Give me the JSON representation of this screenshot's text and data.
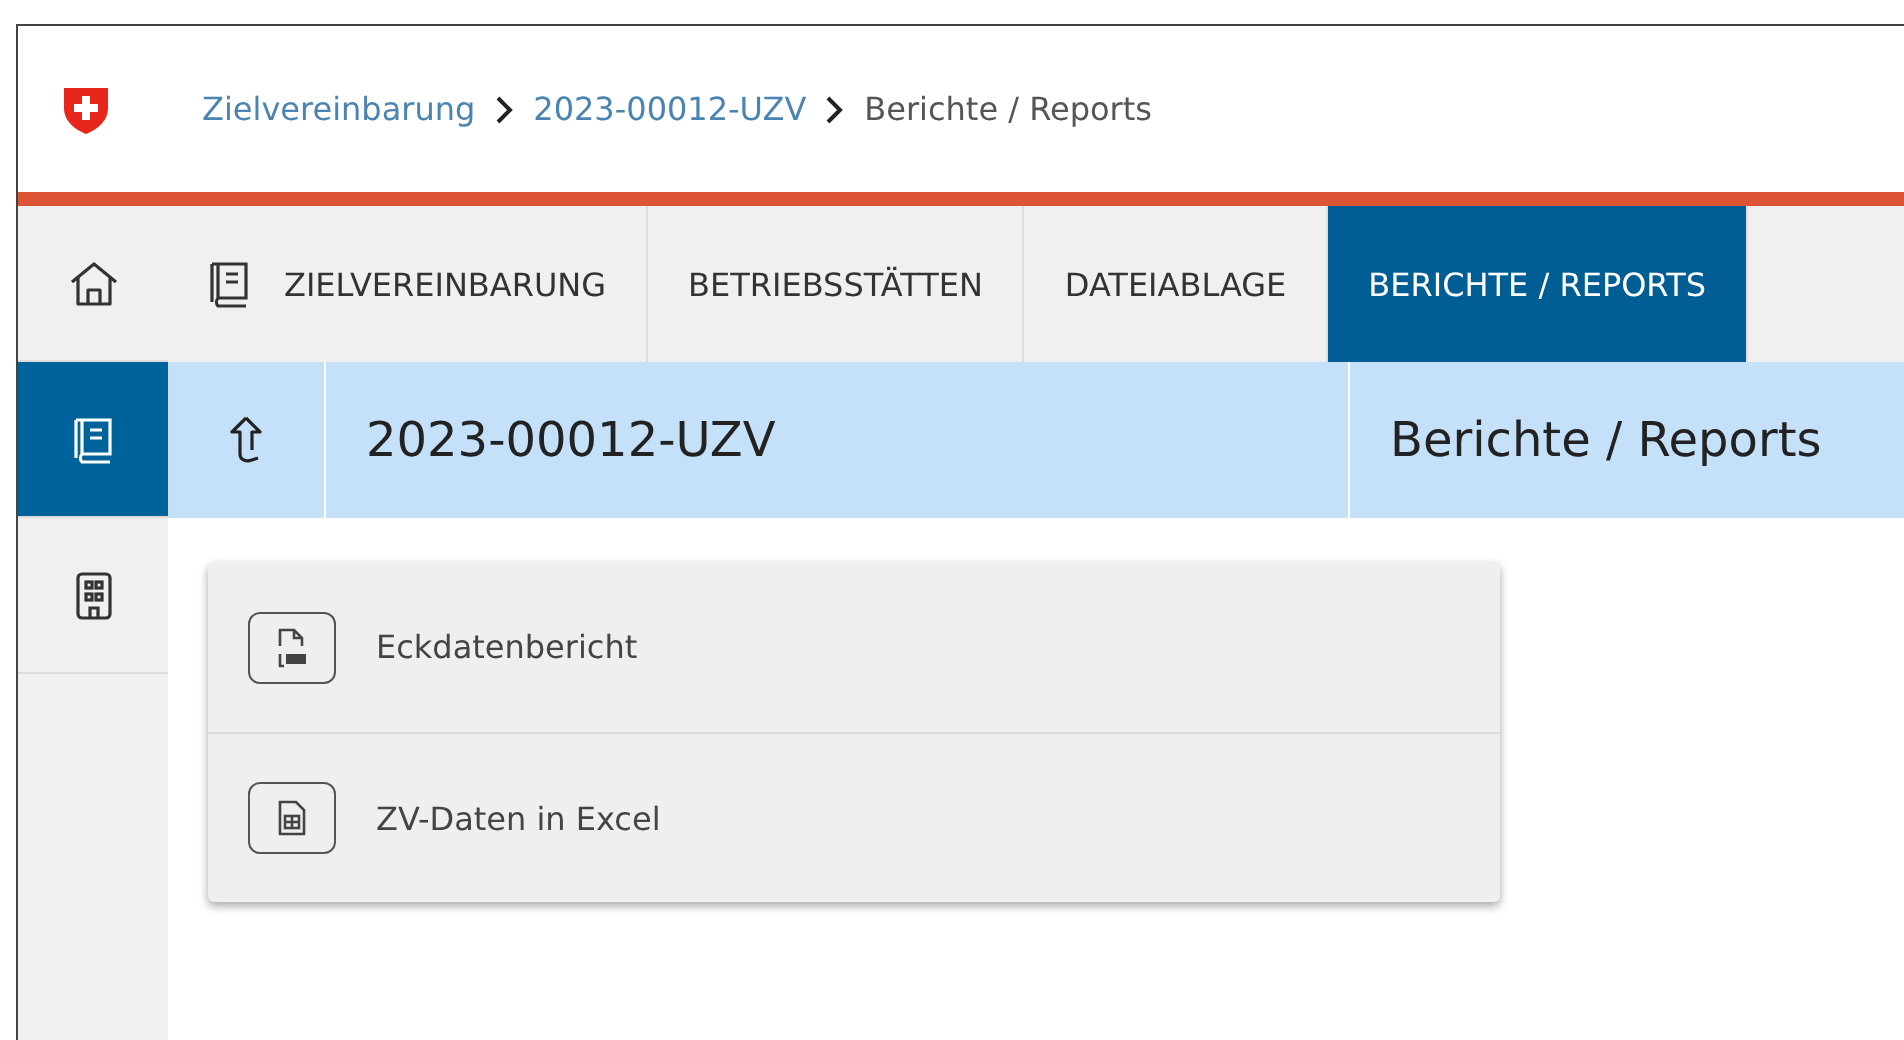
{
  "breadcrumb": [
    {
      "label": "Zielvereinbarung",
      "kind": "link"
    },
    {
      "label": "2023-00012-UZV",
      "kind": "link"
    },
    {
      "label": "Berichte / Reports",
      "kind": "current"
    }
  ],
  "sidebar": {
    "items": [
      {
        "selected": false
      },
      {
        "selected": true
      },
      {
        "selected": false
      }
    ]
  },
  "tabs": [
    {
      "label": "ZIELVEREINBARUNG",
      "kind": "icon",
      "selected": false
    },
    {
      "label": "BETRIEBSSTÄTTEN",
      "kind": "text",
      "selected": false
    },
    {
      "label": "DATEIABLAGE",
      "kind": "text",
      "selected": false
    },
    {
      "label": "BERICHTE / REPORTS",
      "kind": "text",
      "selected": true
    }
  ],
  "context_bar": {
    "title": "2023-00012-UZV",
    "section": "Berichte / Reports"
  },
  "reports": [
    {
      "label": "Eckdatenbericht",
      "kind": "pdf"
    },
    {
      "label": "ZV-Daten in Excel",
      "kind": "excel"
    }
  ]
}
